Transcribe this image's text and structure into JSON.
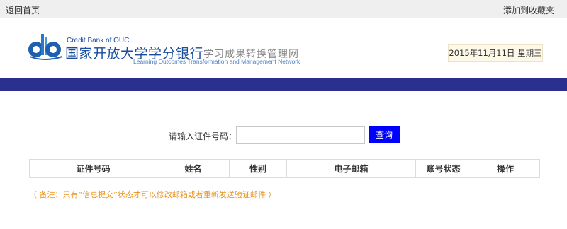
{
  "topbar": {
    "back_label": "返回首页",
    "favorite_label": "添加到收藏夹"
  },
  "header": {
    "brand_en": "Credit Bank of OUC",
    "brand_cn": "国家开放大学学分银行",
    "subtitle_cn": "学习成果转换管理网",
    "subtitle_en": "Learning Outcomes Transformation and Management Network",
    "date": "2015年11月11日 星期三"
  },
  "search": {
    "label": "请输入证件号码：",
    "value": "",
    "button_label": "查询"
  },
  "table": {
    "columns": [
      "证件号码",
      "姓名",
      "性别",
      "电子邮箱",
      "账号状态",
      "操作"
    ]
  },
  "note": "（ 备注：只有“信息提交”状态才可以修改邮箱或者重新发送验证邮件 ）",
  "colors": {
    "nav_bar": "#2b2f8e",
    "brand_blue": "#1a4e9c",
    "search_button": "#0000ff",
    "note_text": "#e8911a",
    "date_box_bg": "#fdf8e8"
  }
}
